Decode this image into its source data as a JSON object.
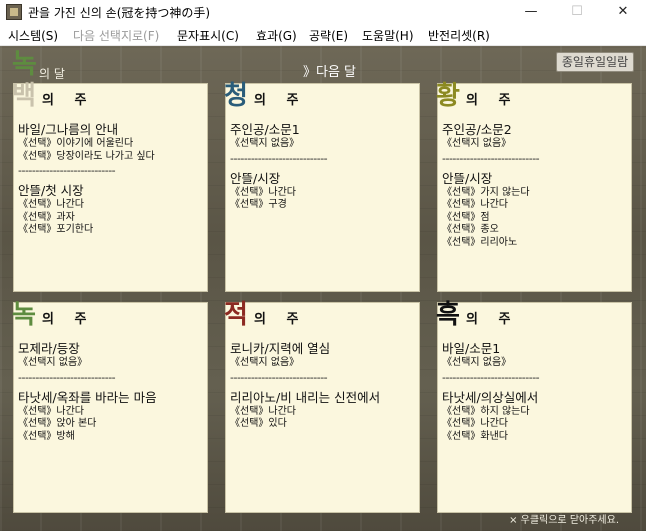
{
  "window": {
    "title": "관을 가진 신의 손(冠を持つ神の手)",
    "minimize": "—",
    "maximize": "☐",
    "close": "✕"
  },
  "menu": [
    {
      "label": "시스템(S)",
      "enabled": true
    },
    {
      "label": "다음 선택지로(F)",
      "enabled": false
    },
    {
      "label": "문자표시(C)",
      "enabled": true
    },
    {
      "label": "효과(G)",
      "enabled": true
    },
    {
      "label": "공략(E)",
      "enabled": true
    },
    {
      "label": "도움말(H)",
      "enabled": true
    },
    {
      "label": "반전리셋(R)",
      "enabled": true
    }
  ],
  "header": {
    "month_char": "녹",
    "month_suffix": "의 달",
    "next_month": "》다음 달",
    "holiday_button": "종일휴일일람"
  },
  "weeks": [
    {
      "char": "백",
      "suffix": "의 주",
      "color": "#c9c2ac",
      "events": [
        {
          "title": "바일/그나름의 안내",
          "choices": [
            "《선택》이야기에 어울린다",
            "《선택》당장이라도 나가고 싶다"
          ]
        },
        {
          "title": "안뜰/첫 시장",
          "choices": [
            "《선택》나간다",
            "《선택》과자",
            "《선택》포기한다"
          ]
        }
      ]
    },
    {
      "char": "청",
      "suffix": "의 주",
      "color": "#2a5d7a",
      "events": [
        {
          "title": "주인공/소문1",
          "choices": [
            "《선택지 없음》"
          ]
        },
        {
          "title": "안뜰/시장",
          "choices": [
            "《선택》나간다",
            "《선택》구경"
          ]
        }
      ]
    },
    {
      "char": "황",
      "suffix": "의 주",
      "color": "#8c8a22",
      "events": [
        {
          "title": "주인공/소문2",
          "choices": [
            "《선택지 없음》"
          ]
        },
        {
          "title": "안뜰/시장",
          "choices": [
            "《선택》가지 않는다",
            "《선택》나간다",
            "《선택》점",
            "《선택》종오",
            "《선택》리리아노"
          ]
        }
      ]
    },
    {
      "char": "녹",
      "suffix": "의 주",
      "color": "#5e8c40",
      "events": [
        {
          "title": "모제라/등장",
          "choices": [
            "《선택지 없음》"
          ]
        },
        {
          "title": "타낫세/옥좌를 바라는 마음",
          "choices": [
            "《선택》나간다",
            "《선택》앉아 본다",
            "《선택》방해"
          ]
        }
      ]
    },
    {
      "char": "적",
      "suffix": "의 주",
      "color": "#8c2a22",
      "events": [
        {
          "title": "로니카/지력에 열심",
          "choices": [
            "《선택지 없음》"
          ]
        },
        {
          "title": "리리아노/비 내리는 신전에서",
          "choices": [
            "《선택》나간다",
            "《선택》있다"
          ]
        }
      ]
    },
    {
      "char": "흑",
      "suffix": "의 주",
      "color": "#111111",
      "events": [
        {
          "title": "바일/소문1",
          "choices": [
            "《선택지 없음》"
          ]
        },
        {
          "title": "타낫세/의상실에서",
          "choices": [
            "《선택》하지 않는다",
            "《선택》나간다",
            "《선택》화낸다"
          ]
        }
      ]
    }
  ],
  "separator": "----------------------------",
  "footer_note": "× 우클릭으로 닫아주세요."
}
